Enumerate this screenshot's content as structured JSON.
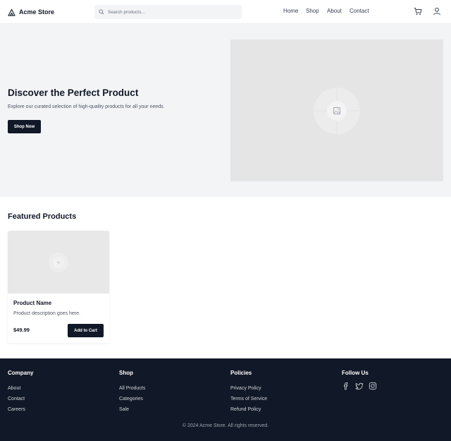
{
  "header": {
    "brand": "Acme Store",
    "search_placeholder": "Search products...",
    "nav": [
      "Home",
      "Shop",
      "About",
      "Contact"
    ],
    "icons": [
      "cart-icon",
      "user-icon"
    ]
  },
  "hero": {
    "title": "Discover the Perfect Product",
    "subtitle": "Explore our curated selection of high-quality products for all your needs.",
    "button": "Shop Now",
    "image_icon": "image-placeholder-icon"
  },
  "featured": {
    "title": "Featured Products",
    "products": [
      {
        "name": "Product Name",
        "description": "Product description goes here.",
        "price": "$49.99",
        "button": "Add to Cart"
      }
    ]
  },
  "footer": {
    "columns": [
      {
        "title": "Company",
        "links": [
          "About",
          "Contact",
          "Careers"
        ]
      },
      {
        "title": "Shop",
        "links": [
          "All Products",
          "Categories",
          "Sale"
        ]
      },
      {
        "title": "Policies",
        "links": [
          "Privacy Policy",
          "Terms of Service",
          "Refund Policy"
        ]
      }
    ],
    "social_title": "Follow Us",
    "social_icons": [
      "facebook-icon",
      "twitter-icon",
      "instagram-icon"
    ],
    "copyright": "© 2024 Acme Store. All rights reserved."
  },
  "colors": {
    "primary": "#111827",
    "hero_bg": "#f3f4f6",
    "placeholder": "#e5e5e5",
    "footer_text": "#d1d5db"
  }
}
